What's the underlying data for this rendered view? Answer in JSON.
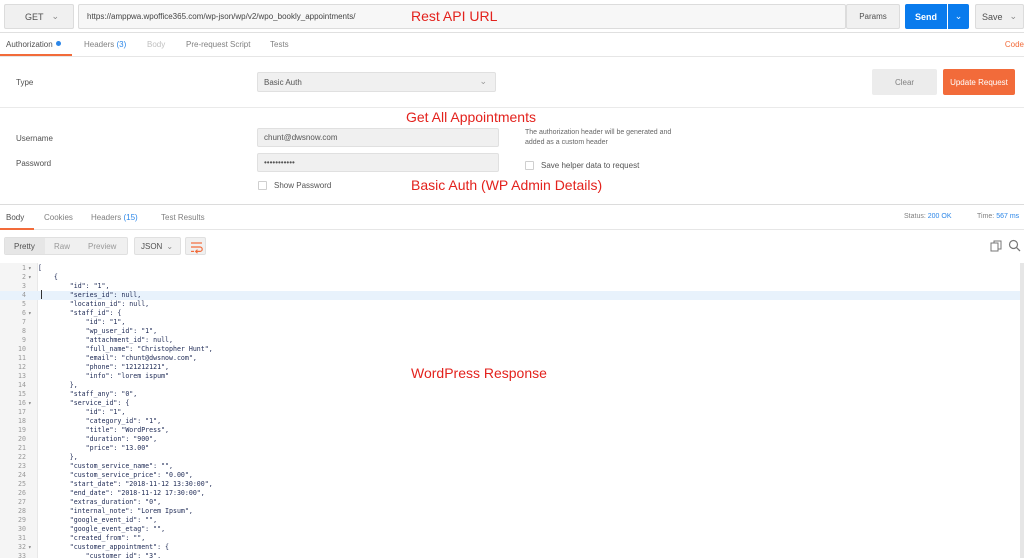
{
  "request": {
    "method": "GET",
    "url": "https://amppwa.wpoffice365.com/wp-json/wp/v2/wpo_bookly_appointments/",
    "params_label": "Params",
    "send_label": "Send",
    "save_label": "Save"
  },
  "annotations": {
    "url": "Rest API URL",
    "get_all": "Get All Appointments",
    "basic_auth": "Basic Auth (WP Admin Details)",
    "response": "WordPress Response"
  },
  "request_tabs": {
    "authorization": "Authorization",
    "headers": "Headers",
    "headers_count": "(3)",
    "body": "Body",
    "prerequest": "Pre-request Script",
    "tests": "Tests",
    "code_link": "Code"
  },
  "auth": {
    "type_label": "Type",
    "type_value": "Basic Auth",
    "clear_label": "Clear",
    "update_label": "Update Request",
    "username_label": "Username",
    "username_value": "chunt@dwsnow.com",
    "password_label": "Password",
    "password_value": "•••••••••••",
    "helper_text": "The authorization header will be generated and added as a custom header",
    "save_helper_label": "Save helper data to request",
    "show_password_label": "Show Password"
  },
  "response_tabs": {
    "body": "Body",
    "cookies": "Cookies",
    "headers": "Headers",
    "headers_count": "(15)",
    "test_results": "Test Results",
    "status_label": "Status:",
    "status_value": "200 OK",
    "time_label": "Time:",
    "time_value": "567 ms"
  },
  "response_toolbar": {
    "pretty": "Pretty",
    "raw": "Raw",
    "preview": "Preview",
    "format": "JSON"
  },
  "code_lines": [
    {
      "n": "1",
      "fold": true,
      "text": "["
    },
    {
      "n": "2",
      "fold": true,
      "text": "    {"
    },
    {
      "n": "3",
      "fold": false,
      "text": "        \"id\": \"1\","
    },
    {
      "n": "4",
      "fold": false,
      "text": "        \"series_id\": null,"
    },
    {
      "n": "5",
      "fold": false,
      "text": "        \"location_id\": null,"
    },
    {
      "n": "6",
      "fold": true,
      "text": "        \"staff_id\": {"
    },
    {
      "n": "7",
      "fold": false,
      "text": "            \"id\": \"1\","
    },
    {
      "n": "8",
      "fold": false,
      "text": "            \"wp_user_id\": \"1\","
    },
    {
      "n": "9",
      "fold": false,
      "text": "            \"attachment_id\": null,"
    },
    {
      "n": "10",
      "fold": false,
      "text": "            \"full_name\": \"Christopher Hunt\","
    },
    {
      "n": "11",
      "fold": false,
      "text": "            \"email\": \"chunt@dwsnow.com\","
    },
    {
      "n": "12",
      "fold": false,
      "text": "            \"phone\": \"121212121\","
    },
    {
      "n": "13",
      "fold": false,
      "text": "            \"info\": \"lorem ispum\""
    },
    {
      "n": "14",
      "fold": false,
      "text": "        },"
    },
    {
      "n": "15",
      "fold": false,
      "text": "        \"staff_any\": \"0\","
    },
    {
      "n": "16",
      "fold": true,
      "text": "        \"service_id\": {"
    },
    {
      "n": "17",
      "fold": false,
      "text": "            \"id\": \"1\","
    },
    {
      "n": "18",
      "fold": false,
      "text": "            \"category_id\": \"1\","
    },
    {
      "n": "19",
      "fold": false,
      "text": "            \"title\": \"WordPress\","
    },
    {
      "n": "20",
      "fold": false,
      "text": "            \"duration\": \"900\","
    },
    {
      "n": "21",
      "fold": false,
      "text": "            \"price\": \"13.00\""
    },
    {
      "n": "22",
      "fold": false,
      "text": "        },"
    },
    {
      "n": "23",
      "fold": false,
      "text": "        \"custom_service_name\": \"\","
    },
    {
      "n": "24",
      "fold": false,
      "text": "        \"custom_service_price\": \"0.00\","
    },
    {
      "n": "25",
      "fold": false,
      "text": "        \"start_date\": \"2018-11-12 13:30:00\","
    },
    {
      "n": "26",
      "fold": false,
      "text": "        \"end_date\": \"2018-11-12 17:30:00\","
    },
    {
      "n": "27",
      "fold": false,
      "text": "        \"extras_duration\": \"0\","
    },
    {
      "n": "28",
      "fold": false,
      "text": "        \"internal_note\": \"Lorem Ipsum\","
    },
    {
      "n": "29",
      "fold": false,
      "text": "        \"google_event_id\": \"\","
    },
    {
      "n": "30",
      "fold": false,
      "text": "        \"google_event_etag\": \"\","
    },
    {
      "n": "31",
      "fold": false,
      "text": "        \"created_from\": \"\","
    },
    {
      "n": "32",
      "fold": true,
      "text": "        \"customer_appointment\": {"
    },
    {
      "n": "33",
      "fold": false,
      "text": "            \"customer_id\": \"3\","
    }
  ],
  "highlighted_line": "4",
  "colors": {
    "accent": "#f26b3a",
    "send": "#097bed",
    "annotation": "#e3221d",
    "status": "#2b86e8"
  }
}
